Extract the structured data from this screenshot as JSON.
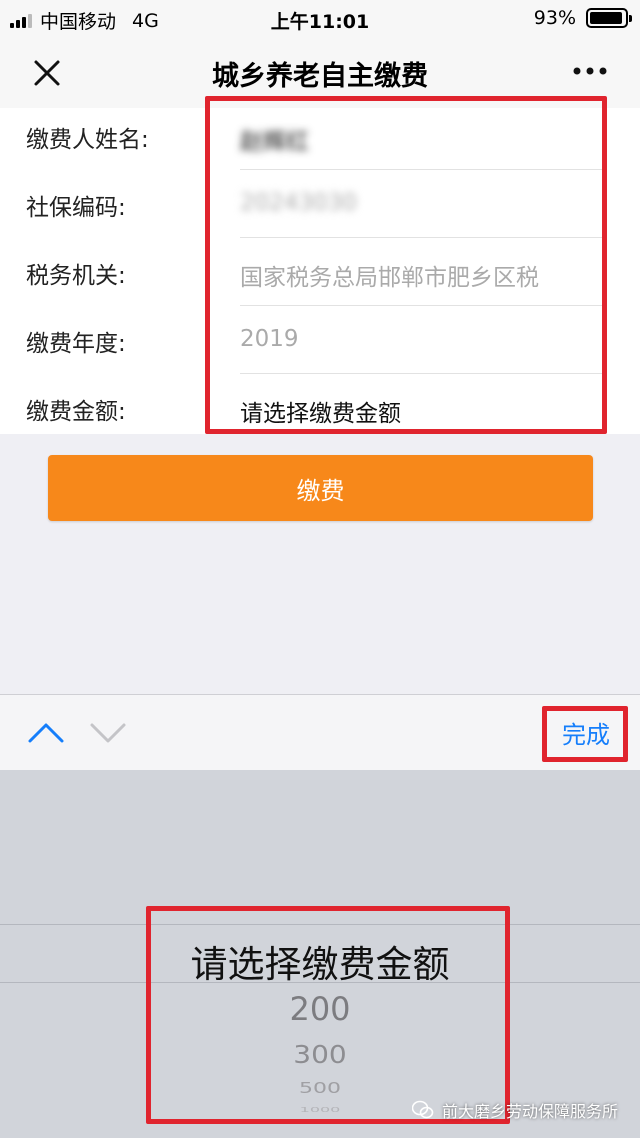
{
  "status_bar": {
    "carrier": "中国移动",
    "network": "4G",
    "time": "上午11:01",
    "battery_text": "93%",
    "battery_level": 0.93
  },
  "nav": {
    "title": "城乡养老自主缴费"
  },
  "form": {
    "rows": [
      {
        "label": "缴费人姓名:",
        "value": "赵辉红"
      },
      {
        "label": "社保编码:",
        "value": "20243030"
      },
      {
        "label": "税务机关:",
        "value": "国家税务总局邯郸市肥乡区税"
      },
      {
        "label": "缴费年度:",
        "value": "2019"
      },
      {
        "label": "缴费金额:",
        "value": "请选择缴费金额"
      }
    ]
  },
  "pay_button": {
    "label": "缴费"
  },
  "toolbar": {
    "done_label": "完成"
  },
  "picker": {
    "selected": "请选择缴费金额",
    "options": [
      "200",
      "300",
      "500",
      "1000"
    ]
  },
  "watermark": {
    "text": "前大磨乡劳动保障服务所"
  },
  "colors": {
    "accent_orange": "#f7881a",
    "link_blue": "#157efb",
    "highlight_red": "#e0242e"
  },
  "icons": [
    "close-icon",
    "more-icon",
    "chevron-up-icon",
    "chevron-down-icon",
    "wechat-icon"
  ]
}
